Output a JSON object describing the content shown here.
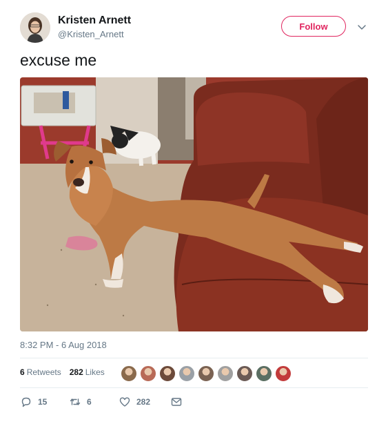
{
  "author": {
    "name": "Kristen Arnett",
    "handle": "@Kristen_Arnett"
  },
  "follow_button": {
    "label": "Follow"
  },
  "tweet": {
    "text": "excuse me",
    "timestamp": "8:32 PM - 6 Aug 2018"
  },
  "stats": {
    "retweets_count": "6",
    "retweets_label": "Retweets",
    "likes_count": "282",
    "likes_label": "Likes"
  },
  "liker_avatars": [
    "#8a6a4c",
    "#b86a57",
    "#6c4a3a",
    "#9aa0a6",
    "#7a6252",
    "#a0a0a0",
    "#6a5a55",
    "#5b6f63",
    "#c23b3b"
  ],
  "actions": {
    "reply_count": "15",
    "retweet_count": "6",
    "like_count": "282"
  },
  "colors": {
    "follow_accent": "#e0245e",
    "secondary_text": "#657786",
    "divider": "#e6ecf0"
  }
}
